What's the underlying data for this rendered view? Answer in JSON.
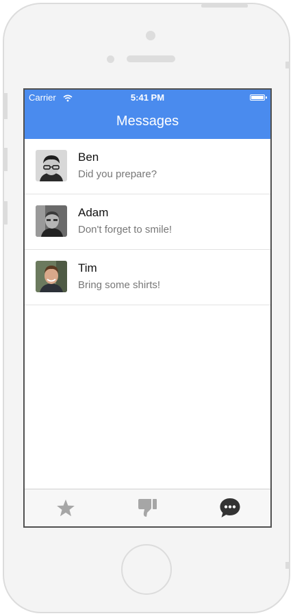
{
  "status_bar": {
    "carrier": "Carrier",
    "time": "5:41 PM"
  },
  "nav": {
    "title": "Messages"
  },
  "messages": [
    {
      "name": "Ben",
      "preview": "Did you prepare?"
    },
    {
      "name": "Adam",
      "preview": "Don't forget to smile!"
    },
    {
      "name": "Tim",
      "preview": "Bring some shirts!"
    }
  ],
  "tab_bar": {
    "tabs": [
      {
        "icon": "star-icon"
      },
      {
        "icon": "thumbs-down-icon"
      },
      {
        "icon": "chat-bubble-icon",
        "active": true
      }
    ]
  },
  "colors": {
    "accent": "#4a8bee",
    "tab_inactive": "#a6a6a6",
    "tab_active": "#333333"
  }
}
